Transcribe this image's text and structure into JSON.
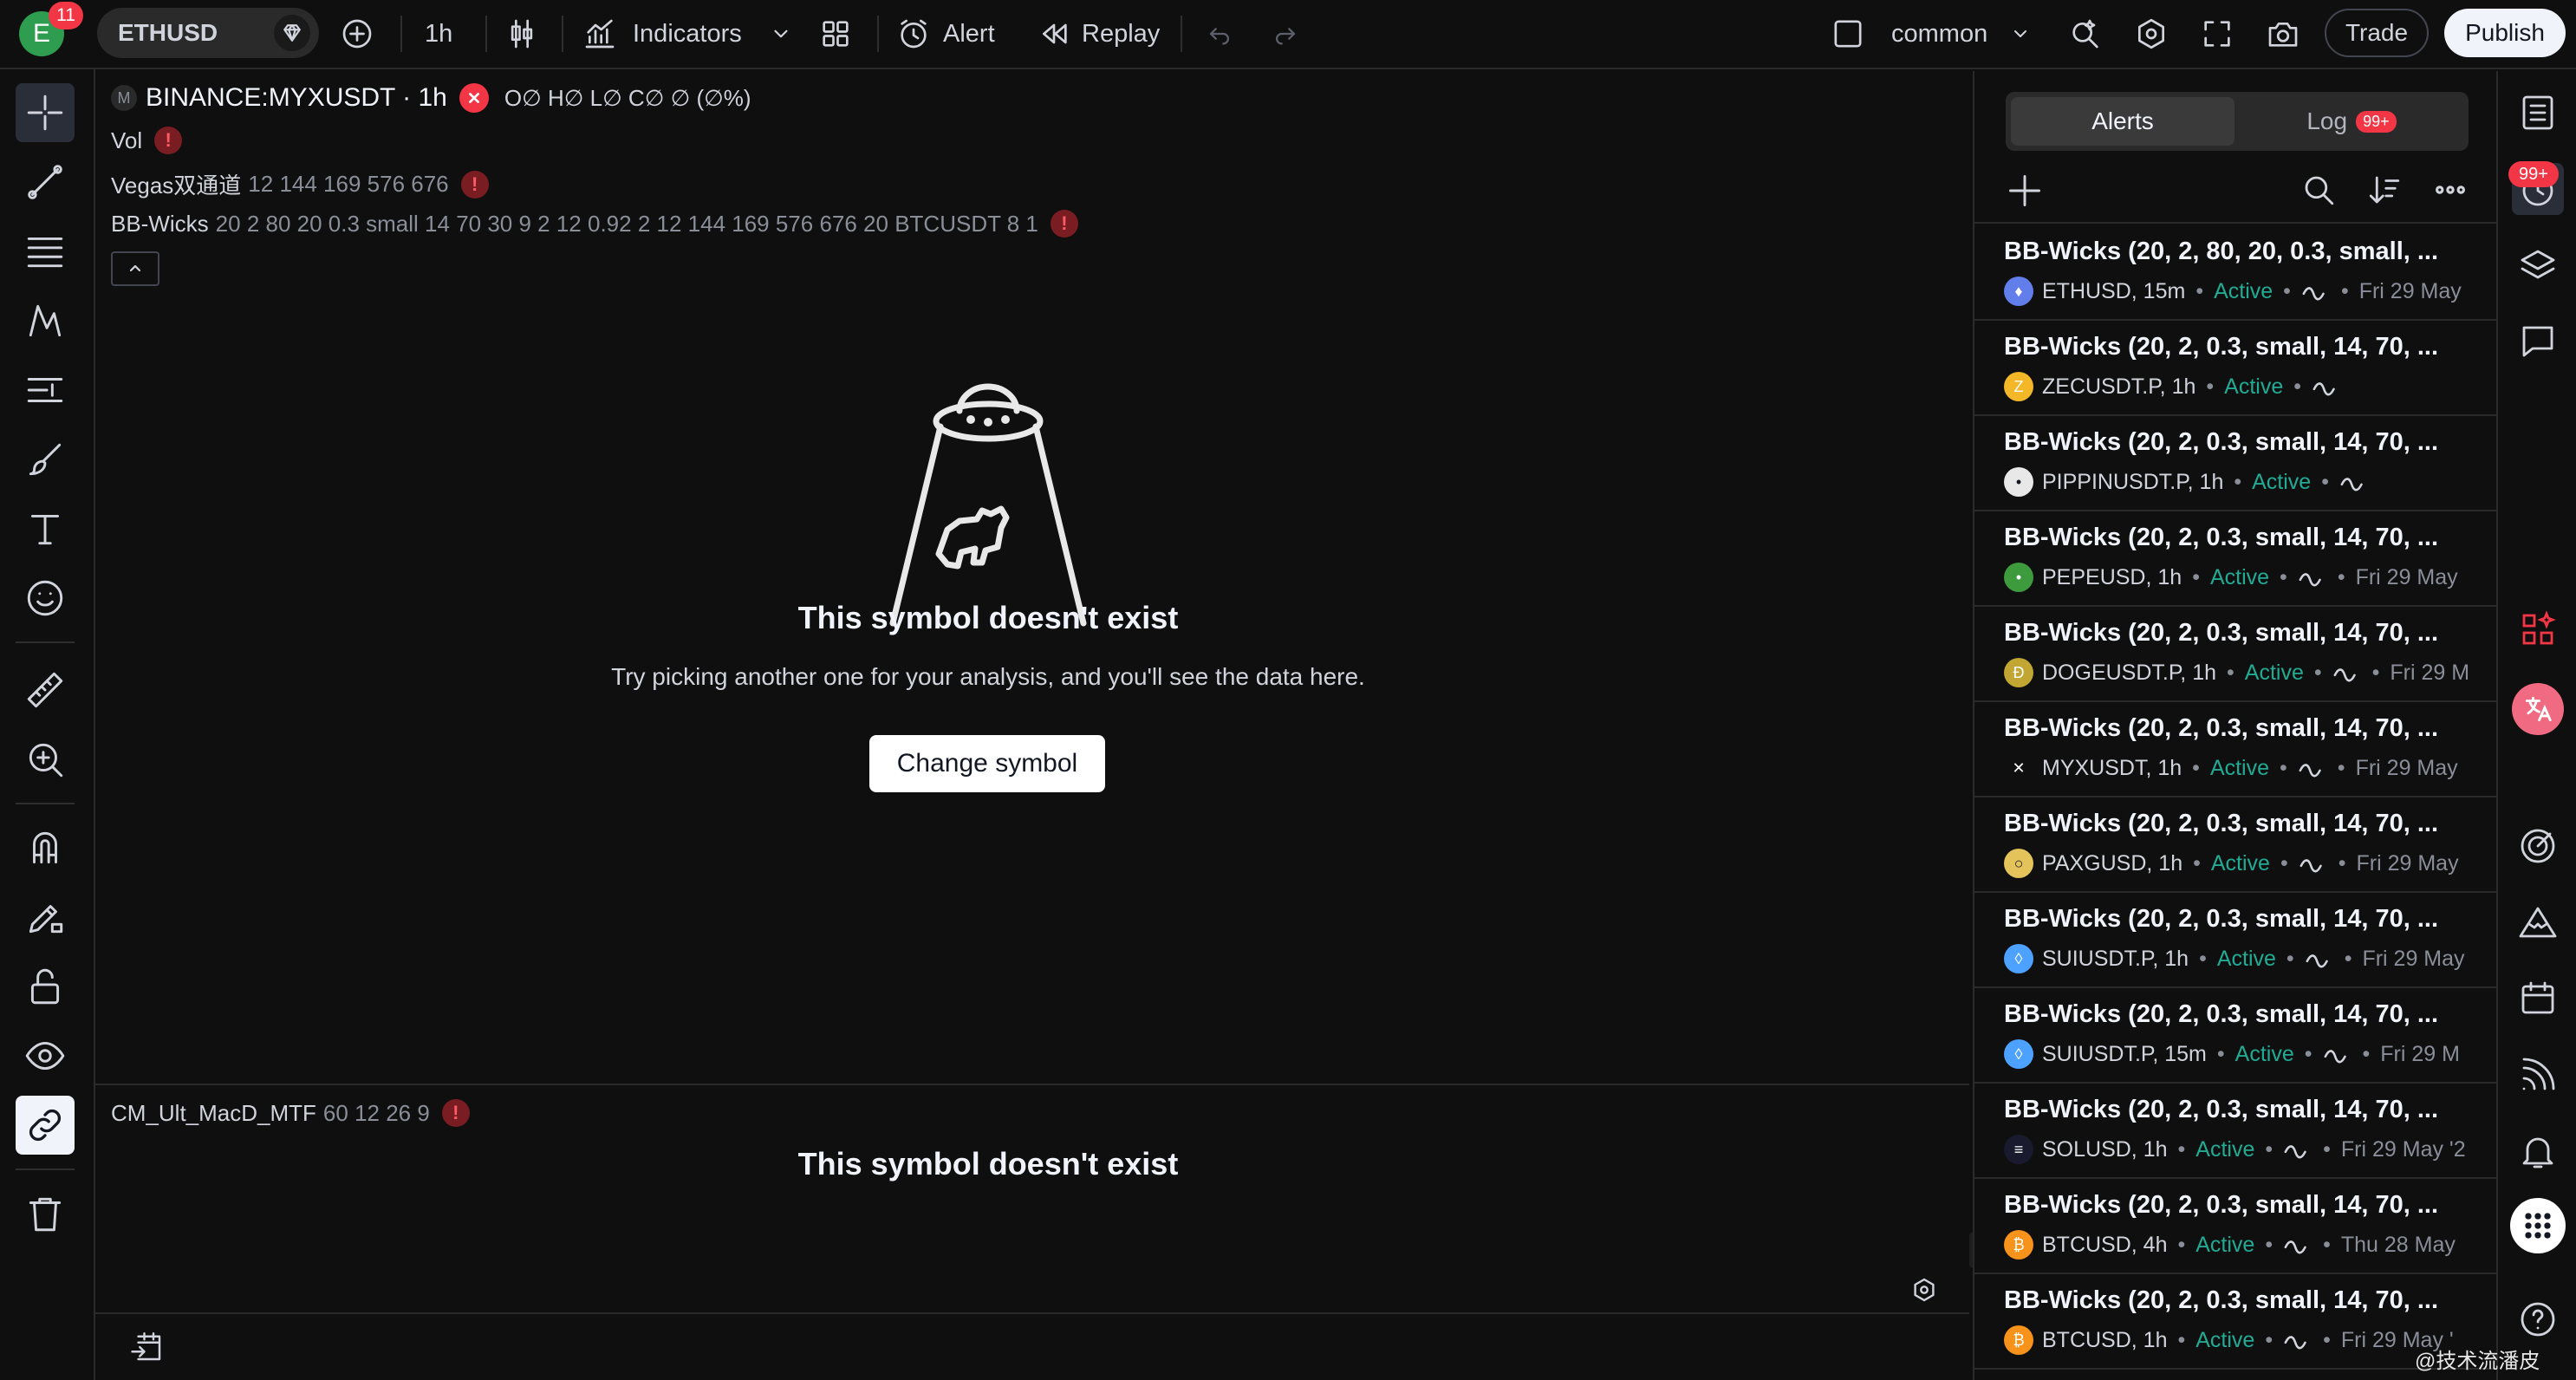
{
  "topbar": {
    "avatar_letter": "E",
    "avatar_badge": "11",
    "symbol": "ETHUSD",
    "interval": "1h",
    "indicators_label": "Indicators",
    "alert_label": "Alert",
    "replay_label": "Replay",
    "layout_name": "common",
    "trade_label": "Trade",
    "publish_label": "Publish"
  },
  "chart": {
    "main_prefix": "M",
    "main_symbol": "BINANCE:MYXUSDT · 1h",
    "ohlc": "O∅ H∅ L∅ C∅ ∅ (∅%)",
    "legends": [
      {
        "name": "Vol",
        "args": ""
      },
      {
        "name": "Vegas双通道",
        "args": "12 144 169 576 676"
      },
      {
        "name": "BB-Wicks",
        "args": "20 2 80 20 0.3 small 14 70 30 9 2 12 0.92 2 12 144 169 576 676 20 BTCUSDT 8 1"
      }
    ],
    "empty_title": "This symbol doesn't exist",
    "empty_sub": "Try picking another one for your analysis, and you'll see the data here.",
    "change_symbol": "Change symbol",
    "lower_pane": {
      "name": "CM_Ult_MacD_MTF",
      "args": "60 12 26 9",
      "empty_title": "This symbol doesn't exist"
    },
    "error_mark": "!"
  },
  "alerts": {
    "tab_alerts": "Alerts",
    "tab_log": "Log",
    "log_badge": "99+",
    "items": [
      {
        "title": "BB-Wicks (20, 2, 80, 20, 0.3, small, ...",
        "symbol": "ETHUSD, 15m",
        "status": "Active",
        "date": "Fri 29 May",
        "coin_color": "#627eea",
        "coin_glyph": "♦"
      },
      {
        "title": "BB-Wicks (20, 2, 0.3, small, 14, 70, ...",
        "symbol": "ZECUSDT.P, 1h",
        "status": "Active",
        "date": "",
        "coin_color": "#f4b728",
        "coin_glyph": "Z"
      },
      {
        "title": "BB-Wicks (20, 2, 0.3, small, 14, 70, ...",
        "symbol": "PIPPINUSDT.P, 1h",
        "status": "Active",
        "date": "",
        "coin_color": "#e8e8e8",
        "coin_glyph": "•"
      },
      {
        "title": "BB-Wicks (20, 2, 0.3, small, 14, 70, ...",
        "symbol": "PEPEUSD, 1h",
        "status": "Active",
        "date": "Fri 29 May",
        "coin_color": "#3d9a3d",
        "coin_glyph": "•"
      },
      {
        "title": "BB-Wicks (20, 2, 0.3, small, 14, 70, ...",
        "symbol": "DOGEUSDT.P, 1h",
        "status": "Active",
        "date": "Fri 29 M",
        "coin_color": "#c2a633",
        "coin_glyph": "Ð"
      },
      {
        "title": "BB-Wicks (20, 2, 0.3, small, 14, 70, ...",
        "symbol": "MYXUSDT, 1h",
        "status": "Active",
        "date": "Fri 29 May",
        "coin_color": "#0f0f0f",
        "coin_glyph": "✕"
      },
      {
        "title": "BB-Wicks (20, 2, 0.3, small, 14, 70, ...",
        "symbol": "PAXGUSD, 1h",
        "status": "Active",
        "date": "Fri 29 May",
        "coin_color": "#e4c35a",
        "coin_glyph": "○"
      },
      {
        "title": "BB-Wicks (20, 2, 0.3, small, 14, 70, ...",
        "symbol": "SUIUSDT.P, 1h",
        "status": "Active",
        "date": "Fri 29 May",
        "coin_color": "#4da2ff",
        "coin_glyph": "◊"
      },
      {
        "title": "BB-Wicks (20, 2, 0.3, small, 14, 70, ...",
        "symbol": "SUIUSDT.P, 15m",
        "status": "Active",
        "date": "Fri 29 M",
        "coin_color": "#4da2ff",
        "coin_glyph": "◊"
      },
      {
        "title": "BB-Wicks (20, 2, 0.3, small, 14, 70, ...",
        "symbol": "SOLUSD, 1h",
        "status": "Active",
        "date": "Fri 29 May '2",
        "coin_color": "#1a1a2e",
        "coin_glyph": "≡"
      },
      {
        "title": "BB-Wicks (20, 2, 0.3, small, 14, 70, ...",
        "symbol": "BTCUSD, 4h",
        "status": "Active",
        "date": "Thu 28 May",
        "coin_color": "#f7931a",
        "coin_glyph": "₿"
      },
      {
        "title": "BB-Wicks (20, 2, 0.3, small, 14, 70, ...",
        "symbol": "BTCUSD, 1h",
        "status": "Active",
        "date": "Fri 29 May '",
        "coin_color": "#f7931a",
        "coin_glyph": "₿"
      }
    ]
  },
  "sidebar": {
    "notif_badge": "99+"
  },
  "watermark": "@技术流潘皮"
}
